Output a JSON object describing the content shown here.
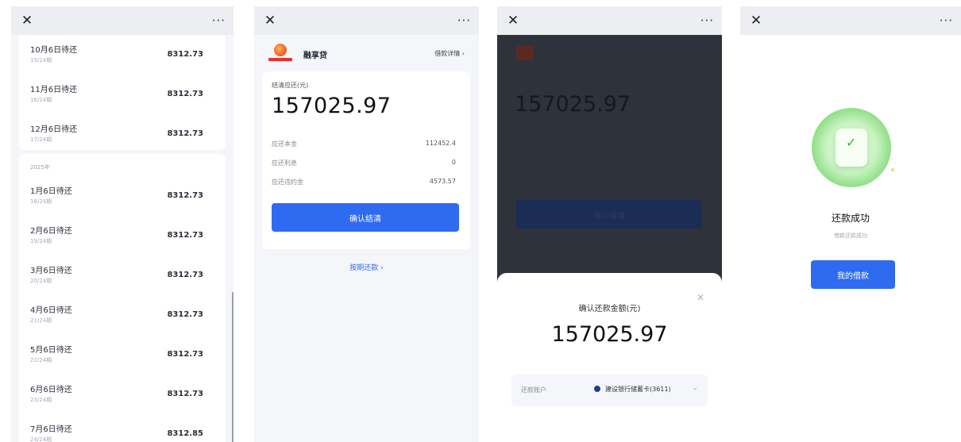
{
  "common": {
    "close_glyph": "✕",
    "more_glyph": "···"
  },
  "panel1": {
    "top_rows": [
      {
        "title": "10月6日待还",
        "sub": "15/24期",
        "amount": "8312.73"
      },
      {
        "title": "11月6日待还",
        "sub": "16/24期",
        "amount": "8312.73"
      },
      {
        "title": "12月6日待还",
        "sub": "17/24期",
        "amount": "8312.73"
      }
    ],
    "year": "2025年",
    "rows": [
      {
        "title": "1月6日待还",
        "sub": "18/24期",
        "amount": "8312.73"
      },
      {
        "title": "2月6日待还",
        "sub": "19/24期",
        "amount": "8312.73"
      },
      {
        "title": "3月6日待还",
        "sub": "20/24期",
        "amount": "8312.73"
      },
      {
        "title": "4月6日待还",
        "sub": "21/24期",
        "amount": "8312.73"
      },
      {
        "title": "5月6日待还",
        "sub": "22/24期",
        "amount": "8312.73"
      },
      {
        "title": "6月6日待还",
        "sub": "23/24期",
        "amount": "8312.73"
      },
      {
        "title": "7月6日待还",
        "sub": "24/24期",
        "amount": "8312.85"
      }
    ]
  },
  "panel2": {
    "brand": "融享贷",
    "loan_detail_link": "借款详情 ›",
    "amount_label": "结清应还(元)",
    "amount": "157025.97",
    "details": [
      {
        "label": "应还本金",
        "value": "112452.4"
      },
      {
        "label": "应还利息",
        "value": "0"
      },
      {
        "label": "应还违约金",
        "value": "4573.57"
      }
    ],
    "confirm_button": "确认结清",
    "other_link": "按期还款 ›"
  },
  "panel3": {
    "ghost_amount": "157025.97",
    "ghost_button": "确认结清",
    "sheet": {
      "title": "确认还款金额(元)",
      "amount": "157025.97",
      "account_label": "还款账户",
      "account_value": "建设银行储蓄卡(3611)",
      "chevron": "⌄",
      "close": "✕"
    }
  },
  "panel4": {
    "check": "✓",
    "title": "还款成功",
    "subtitle": "借款还款成功",
    "button": "我的借款"
  }
}
